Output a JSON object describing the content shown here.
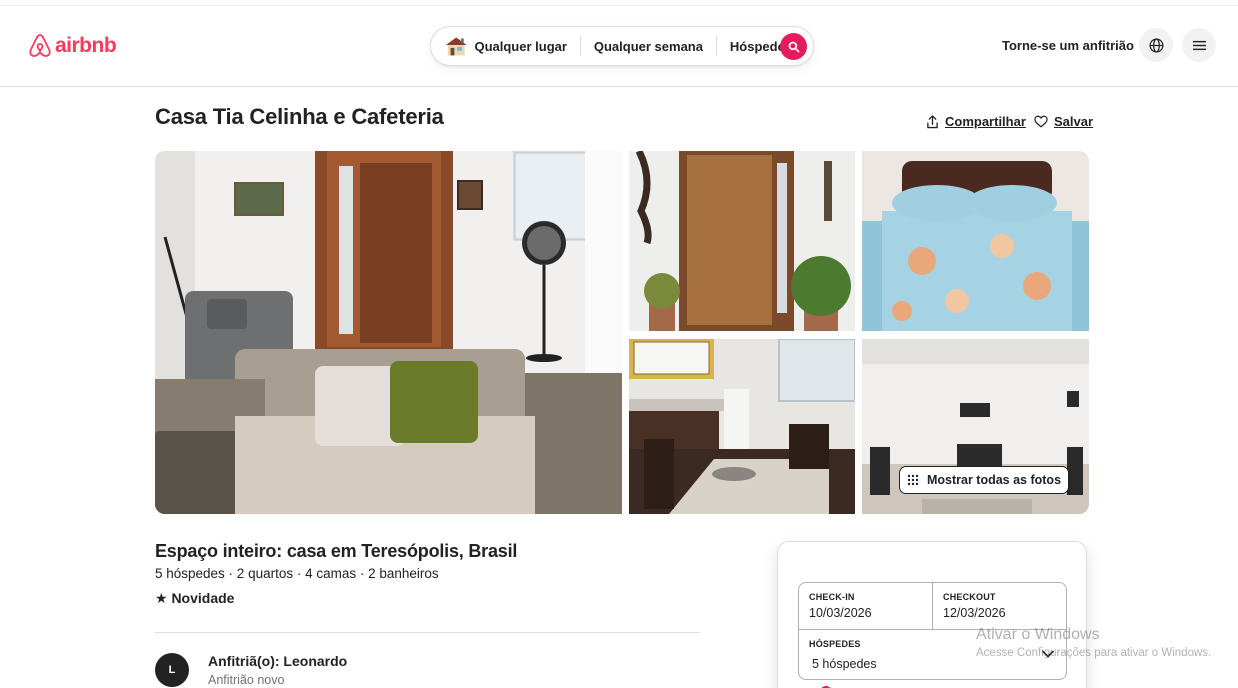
{
  "header": {
    "logo_text": "airbnb",
    "search": {
      "location": "Qualquer lugar",
      "week": "Qualquer semana",
      "guests": "Hóspedes?"
    },
    "host_link": "Torne-se um anfitrião"
  },
  "listing": {
    "title": "Casa Tia Celinha e Cafeteria",
    "share_label": "Compartilhar",
    "save_label": "Salvar",
    "show_all_photos": "Mostrar todas as fotos",
    "space_title": "Espaço inteiro: casa em Teresópolis, Brasil",
    "details": "5 hóspedes · 2 quartos · 4 camas · 2 banheiros",
    "badge": "★ Novidade"
  },
  "host": {
    "initial": "L",
    "name": "Anfitriã(o): Leonardo",
    "subtitle": "Anfitrião novo"
  },
  "booking": {
    "checkin_label": "CHECK-IN",
    "checkin_value": "10/03/2026",
    "checkout_label": "CHECKOUT",
    "checkout_value": "12/03/2026",
    "guests_label": "HÓSPEDES",
    "guests_value": "5 hóspedes"
  },
  "watermark": {
    "title": "Ativar o Windows",
    "subtitle": "Acesse Configurações para ativar o Windows."
  },
  "icons": {
    "logo": "airbnb-logo-icon",
    "search": "search-icon",
    "share": "share-icon",
    "save": "heart-icon",
    "globe": "globe-icon",
    "menu": "hamburger-icon",
    "grid": "grid-dots-icon",
    "chevron": "chevron-down-icon"
  },
  "colors": {
    "brand": "#ff385c",
    "search_button": "#e31c5f"
  }
}
